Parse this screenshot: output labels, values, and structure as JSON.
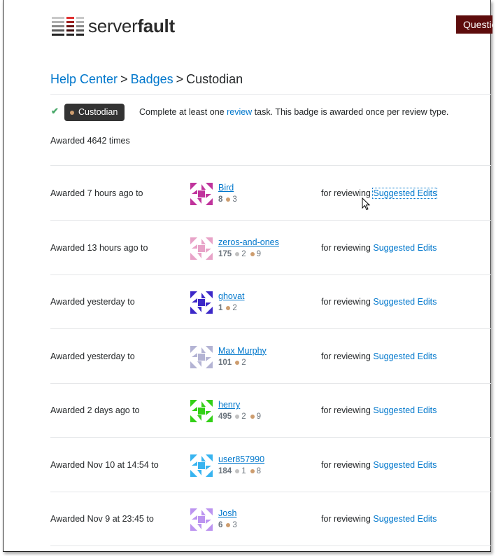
{
  "header": {
    "logo_text_light": "server",
    "logo_text_bold": "fault",
    "questions_button": "Questions"
  },
  "breadcrumb": {
    "items": [
      "Help Center",
      "Badges"
    ],
    "separator": ">",
    "current": "Custodian"
  },
  "badge": {
    "earned": true,
    "name": "Custodian",
    "tier": "bronze",
    "desc_before": "Complete at least one ",
    "desc_link": "review",
    "desc_after": " task. This badge is awarded once per review type.",
    "awarded_count_text": "Awarded 4642 times"
  },
  "colors": {
    "link": "#0077cc",
    "bronze": "#cd9d6f",
    "silver": "#c0c0c0",
    "badge_bg": "#333333",
    "check": "#48a868",
    "brand_button": "#5d0c0c"
  },
  "awards": [
    {
      "when": "Awarded 7 hours ago to",
      "user": "Bird",
      "rep": "8",
      "silver": null,
      "bronze": "3",
      "for_text": "for reviewing",
      "review_type": "Suggested Edits",
      "avatar_color": "#c0349c",
      "focused": true
    },
    {
      "when": "Awarded 13 hours ago to",
      "user": "zeros-and-ones",
      "rep": "175",
      "silver": "2",
      "bronze": "9",
      "for_text": "for reviewing",
      "review_type": "Suggested Edits",
      "avatar_color": "#e8a3c8",
      "focused": false
    },
    {
      "when": "Awarded yesterday to",
      "user": "ghovat",
      "rep": "1",
      "silver": null,
      "bronze": "2",
      "for_text": "for reviewing",
      "review_type": "Suggested Edits",
      "avatar_color": "#3c28c8",
      "focused": false
    },
    {
      "when": "Awarded yesterday to",
      "user": "Max Murphy",
      "rep": "101",
      "silver": null,
      "bronze": "2",
      "for_text": "for reviewing",
      "review_type": "Suggested Edits",
      "avatar_color": "#b4b4d4",
      "focused": false
    },
    {
      "when": "Awarded 2 days ago to",
      "user": "henry",
      "rep": "495",
      "silver": "2",
      "bronze": "9",
      "for_text": "for reviewing",
      "review_type": "Suggested Edits",
      "avatar_color": "#34d018",
      "focused": false
    },
    {
      "when": "Awarded Nov 10 at 14:54 to",
      "user": "user857990",
      "rep": "184",
      "silver": "1",
      "bronze": "8",
      "for_text": "for reviewing",
      "review_type": "Suggested Edits",
      "avatar_color": "#38b4f0",
      "focused": false
    },
    {
      "when": "Awarded Nov 9 at 23:45 to",
      "user": "Josh",
      "rep": "6",
      "silver": null,
      "bronze": "3",
      "for_text": "for reviewing",
      "review_type": "Suggested Edits",
      "avatar_color": "#bc94f0",
      "focused": false
    }
  ]
}
